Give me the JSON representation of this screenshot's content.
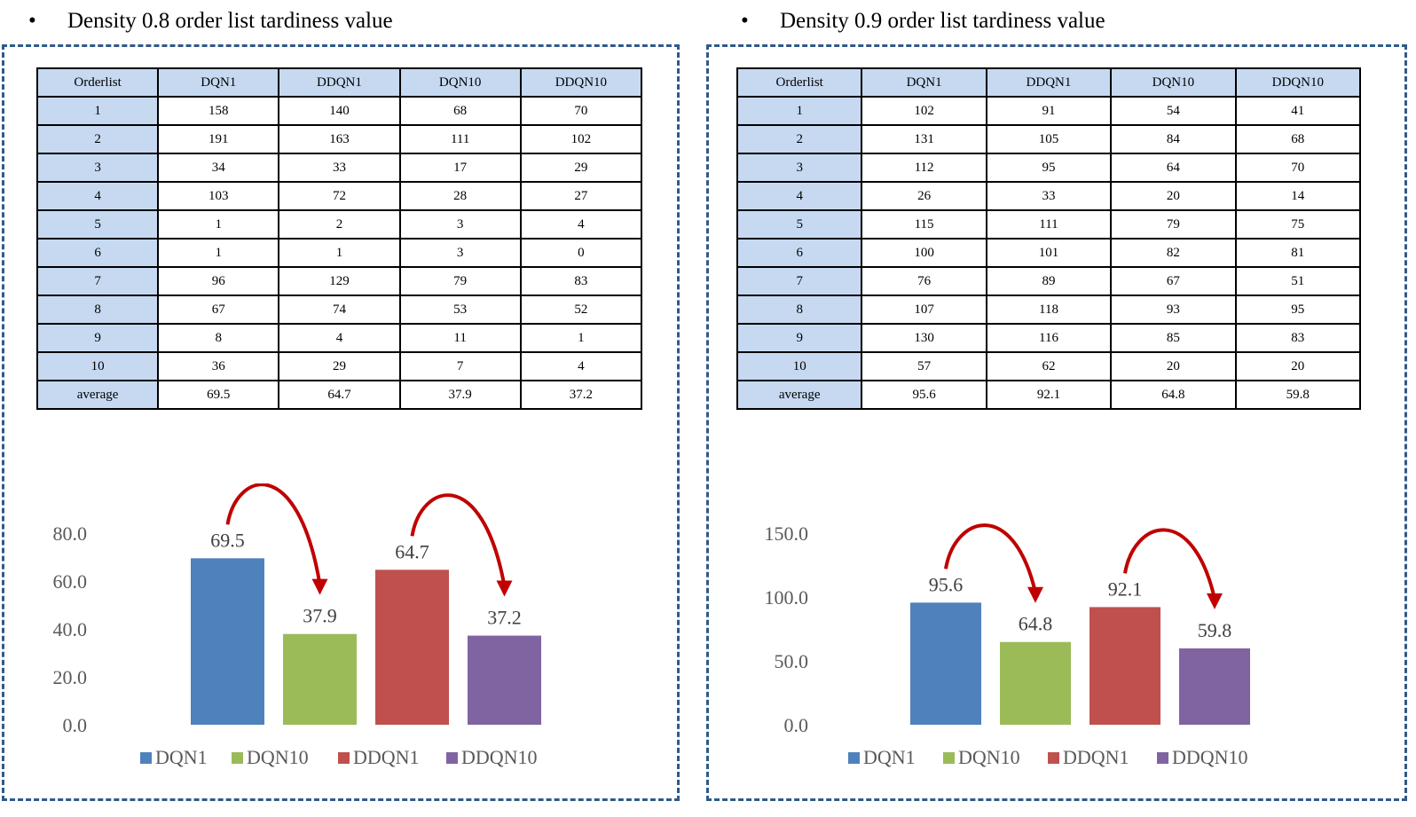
{
  "colors": {
    "frame": "#2f5a8a",
    "header_fill": "#c6d9f1",
    "arrow": "#c00000",
    "series": [
      "#4f81bd",
      "#9bbb59",
      "#c0504d",
      "#8064a2"
    ]
  },
  "panels": [
    {
      "heading": "Density 0.8 order list tardiness value",
      "table": {
        "columns": [
          "Orderlist",
          "DQN1",
          "DDQN1",
          "DQN10",
          "DDQN10"
        ],
        "rows": [
          [
            "1",
            "158",
            "140",
            "68",
            "70"
          ],
          [
            "2",
            "191",
            "163",
            "111",
            "102"
          ],
          [
            "3",
            "34",
            "33",
            "17",
            "29"
          ],
          [
            "4",
            "103",
            "72",
            "28",
            "27"
          ],
          [
            "5",
            "1",
            "2",
            "3",
            "4"
          ],
          [
            "6",
            "1",
            "1",
            "3",
            "0"
          ],
          [
            "7",
            "96",
            "129",
            "79",
            "83"
          ],
          [
            "8",
            "67",
            "74",
            "53",
            "52"
          ],
          [
            "9",
            "8",
            "4",
            "11",
            "1"
          ],
          [
            "10",
            "36",
            "29",
            "7",
            "4"
          ],
          [
            "average",
            "69.5",
            "64.7",
            "37.9",
            "37.2"
          ]
        ]
      }
    },
    {
      "heading": "Density 0.9 order list tardiness value",
      "table": {
        "columns": [
          "Orderlist",
          "DQN1",
          "DDQN1",
          "DQN10",
          "DDQN10"
        ],
        "rows": [
          [
            "1",
            "102",
            "91",
            "54",
            "41"
          ],
          [
            "2",
            "131",
            "105",
            "84",
            "68"
          ],
          [
            "3",
            "112",
            "95",
            "64",
            "70"
          ],
          [
            "4",
            "26",
            "33",
            "20",
            "14"
          ],
          [
            "5",
            "115",
            "111",
            "79",
            "75"
          ],
          [
            "6",
            "100",
            "101",
            "82",
            "81"
          ],
          [
            "7",
            "76",
            "89",
            "67",
            "51"
          ],
          [
            "8",
            "107",
            "118",
            "93",
            "95"
          ],
          [
            "9",
            "130",
            "116",
            "85",
            "83"
          ],
          [
            "10",
            "57",
            "62",
            "20",
            "20"
          ],
          [
            "average",
            "95.6",
            "92.1",
            "64.8",
            "59.8"
          ]
        ]
      }
    }
  ],
  "chart_data": [
    {
      "type": "bar",
      "categories": [
        "DQN1",
        "DQN10",
        "DDQN1",
        "DDQN10"
      ],
      "values": [
        69.5,
        37.9,
        64.7,
        37.2
      ],
      "value_labels": [
        "69.5",
        "37.9",
        "64.7",
        "37.2"
      ],
      "yticks": [
        "0.0",
        "20.0",
        "40.0",
        "60.0",
        "80.0"
      ],
      "ylim": [
        0,
        80
      ],
      "legend": [
        "DQN1",
        "DQN10",
        "DDQN1",
        "DDQN10"
      ],
      "legend_position": "bottom",
      "grid": false,
      "annotations": [
        "arrow DQN1 to DQN10",
        "arrow DDQN1 to DDQN10"
      ]
    },
    {
      "type": "bar",
      "categories": [
        "DQN1",
        "DQN10",
        "DDQN1",
        "DDQN10"
      ],
      "values": [
        95.6,
        64.8,
        92.1,
        59.8
      ],
      "value_labels": [
        "95.6",
        "64.8",
        "92.1",
        "59.8"
      ],
      "yticks": [
        "0.0",
        "50.0",
        "100.0",
        "150.0"
      ],
      "ylim": [
        0,
        150
      ],
      "legend": [
        "DQN1",
        "DQN10",
        "DDQN1",
        "DDQN10"
      ],
      "legend_position": "bottom",
      "grid": false,
      "annotations": [
        "arrow DQN1 to DQN10",
        "arrow DDQN1 to DDQN10"
      ]
    }
  ]
}
